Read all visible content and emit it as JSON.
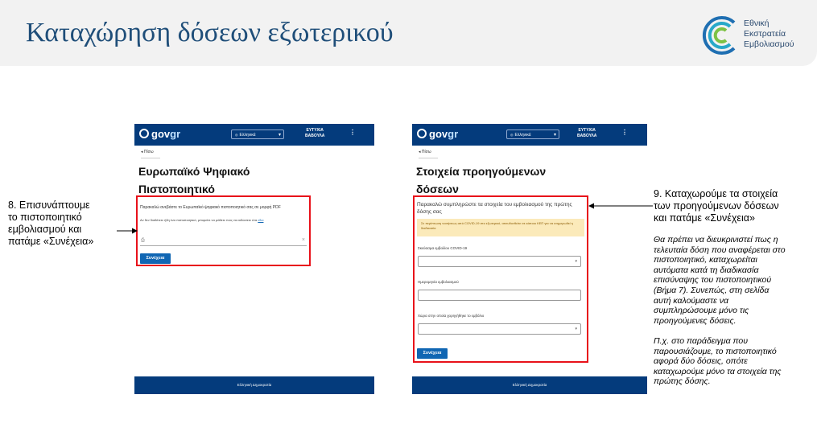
{
  "slide": {
    "title": "Καταχώρηση δόσεων εξωτερικού",
    "logo_lines": [
      "Εθνική",
      "Εκστρατεία",
      "Εμβολιασμού"
    ]
  },
  "screen_left": {
    "brand": "gov",
    "brand_accent": "gr",
    "language": "Ελληνικά",
    "user_lines": [
      "ΕΥΤΥΧΙΑ",
      "ΒΑΒΟΥΛΑ"
    ],
    "menu_icon": "⋮",
    "back": "Πίσω",
    "title_lines": [
      "Ευρωπαϊκό Ψηφιακό",
      "Πιστοποιητικό"
    ],
    "instruction": "Παρακαλώ ανεβάστε το Ευρωπαϊκό ψηφιακό πιστοποιητικό σας σε μορφή PDF",
    "note_prefix": "Αν δεν διαθέτετε ήδη ένα πιστοποιητικό, μπορείτε να μάθετε πώς να εκδώσετε ένα",
    "note_link": "εδώ",
    "continue": "Συνέχεια",
    "footer": "Ελληνική Δημοκρατία"
  },
  "screen_right": {
    "brand": "gov",
    "brand_accent": "gr",
    "language": "Ελληνικά",
    "user_lines": [
      "ΕΥΤΥΧΙΑ",
      "ΒΑΒΟΥΛΑ"
    ],
    "menu_icon": "⋮",
    "back": "Πίσω",
    "title_lines": [
      "Στοιχεία προηγούμενων",
      "δόσεων"
    ],
    "intro": "Παρακαλώ συμπληρώστε τα στοιχεία του εμβολιασμού της πρώτης δόσης σας",
    "warning": "Σε περίπτωση νοσήσεως από COVID-19 στο εξωτερικό, απευθυνθείτε σε κάποιο ΚΕΠ για να ενημερωθεί η διαδικασία",
    "field1_label": "Σκεύασμα εμβολίου COVID-19",
    "field2_label": "Ημερομηνία εμβολιασμού",
    "field3_label": "Χώρα στην οποία χορηγήθηκε το εμβόλιο",
    "continue": "Συνέχεια",
    "footer": "Ελληνική Δημοκρατία"
  },
  "caption_left": [
    "8. Επισυνάπτουμε",
    "το πιστοποιητικό",
    "εμβολιασμού και",
    "πατάμε «Συνέχεια»"
  ],
  "caption_right": [
    "9. Καταχωρούμε τα στοιχεία",
    "των προηγούμενων δόσεων",
    "και πατάμε «Συνέχεια»"
  ],
  "note_right": [
    "Θα πρέπει να διευκρινιστεί πως η",
    "τελευταία δόση που αναφέρεται στο",
    "πιστοποιητικό, καταχωρείται",
    "αυτόματα κατά τη διαδικασία",
    "επισύναψης του πιστοποιητικού",
    "(Βήμα 7). Συνεπώς, στη σελίδα",
    "αυτή καλούμαστε να",
    "συμπληρώσουμε μόνο τις",
    "προηγούμενες δόσεις.",
    "",
    "Π.χ. στο παράδειγμα που",
    "παρουσιάζουμε, το πιστοποιητικό",
    "αφορά δύο δόσεις, οπότε",
    "καταχωρούμε μόνο τα στοιχεία της",
    "πρώτης δόσης."
  ],
  "colors": {
    "title": "#1f4e79",
    "navbar": "#043b7c",
    "highlight": "#e8111a",
    "button": "#1066b3"
  }
}
